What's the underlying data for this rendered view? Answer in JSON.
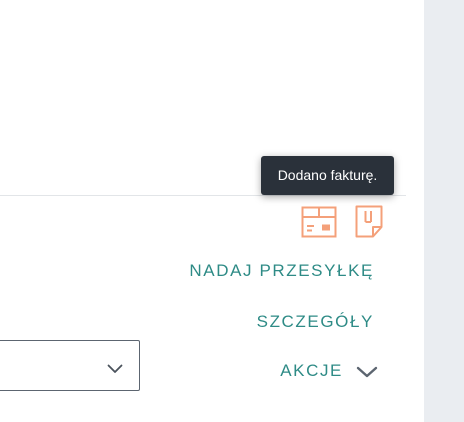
{
  "tooltip": {
    "text": "Dodano fakturę."
  },
  "icons": {
    "parcel": "parcel-box-icon",
    "invoice": "invoice-document-icon",
    "color": "#f4a07a"
  },
  "actions": {
    "send_label": "NADAJ PRZESYŁKĘ",
    "details_label": "SZCZEGÓŁY",
    "actions_label": "AKCJE",
    "color": "#2e8b86"
  },
  "select": {
    "value": ""
  }
}
